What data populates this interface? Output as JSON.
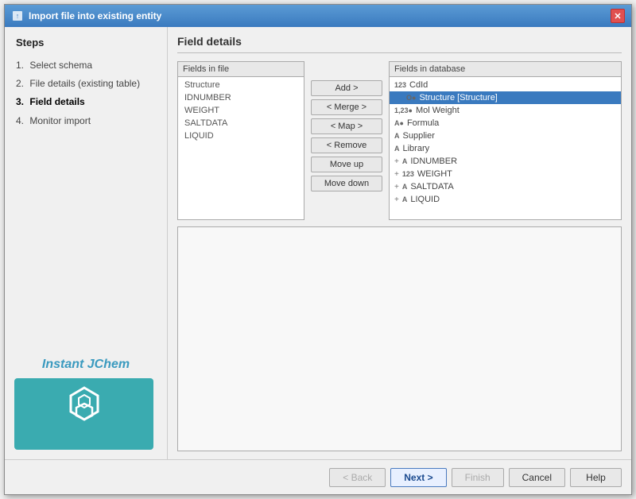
{
  "dialog": {
    "title": "Import file into existing entity",
    "close_label": "✕"
  },
  "sidebar": {
    "steps_label": "Steps",
    "steps": [
      {
        "num": "1.",
        "label": "Select schema",
        "active": false
      },
      {
        "num": "2.",
        "label": "File details (existing table)",
        "active": false
      },
      {
        "num": "3.",
        "label": "Field details",
        "active": true
      },
      {
        "num": "4.",
        "label": "Monitor import",
        "active": false
      }
    ],
    "branding_name": "Instant JChem"
  },
  "panel": {
    "title": "Field details",
    "fields_in_file_label": "Fields in file",
    "fields_in_database_label": "Fields in database",
    "file_fields": [
      {
        "name": "Structure"
      },
      {
        "name": "IDNUMBER"
      },
      {
        "name": "WEIGHT"
      },
      {
        "name": "SALTDATA"
      },
      {
        "name": "LIQUID"
      }
    ],
    "db_fields": [
      {
        "prefix": "",
        "type": "123",
        "name": "CdId"
      },
      {
        "prefix": "→",
        "type": "O●",
        "name": "Structure [Structure]",
        "arrow": true
      },
      {
        "prefix": "",
        "type": "1,23●",
        "name": "Mol Weight"
      },
      {
        "prefix": "",
        "type": "A●",
        "name": "Formula"
      },
      {
        "prefix": "",
        "type": "A",
        "name": "Supplier"
      },
      {
        "prefix": "",
        "type": "A",
        "name": "Library"
      },
      {
        "prefix": "+",
        "type": "A",
        "name": "IDNUMBER"
      },
      {
        "prefix": "+",
        "type": "123",
        "name": "WEIGHT"
      },
      {
        "prefix": "+",
        "type": "A",
        "name": "SALTDATA"
      },
      {
        "prefix": "+",
        "type": "A",
        "name": "LIQUID"
      }
    ],
    "buttons": {
      "add": "Add >",
      "merge": "< Merge >",
      "map": "< Map >",
      "remove": "< Remove",
      "move_up": "Move up",
      "move_down": "Move down"
    }
  },
  "footer": {
    "back_label": "< Back",
    "next_label": "Next >",
    "finish_label": "Finish",
    "cancel_label": "Cancel",
    "help_label": "Help"
  }
}
